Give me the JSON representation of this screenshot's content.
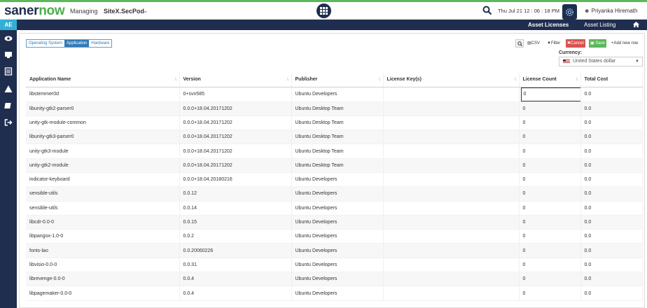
{
  "header": {
    "logo_part1": "saner",
    "logo_part2": "now",
    "managing_label": "Managing",
    "site_name": "SiteX.SecPod",
    "datetime": "Thu Jul 21  12 : 06 : 18 PM",
    "user_name": "Priyanka Hiremath"
  },
  "subnav": {
    "badge": "AE",
    "links": [
      "Asset Licenses",
      "Asset Listing"
    ]
  },
  "tabs": [
    {
      "label": "Operating System",
      "active": false
    },
    {
      "label": "Application",
      "active": true
    },
    {
      "label": "Hardware",
      "active": false
    }
  ],
  "toolbar": {
    "csv_label": "CSV",
    "filter_label": "Filter",
    "cancel_label": "Cancel",
    "save_label": "Save",
    "add_label": "Add new row"
  },
  "currency": {
    "label": "Currency:",
    "selected": "United States dollar"
  },
  "table": {
    "columns": [
      "Application Name",
      "Version",
      "Publisher",
      "License Key(s)",
      "License Count",
      "Total Cost"
    ],
    "rows": [
      [
        "libstemmer0d",
        "0+svn585",
        "Ubuntu Developers",
        "",
        "0",
        "0.0"
      ],
      [
        "libunity-gtk2-parser0",
        "0.0.0+18.04.20171202",
        "Ubuntu Desktop Team",
        "",
        "0",
        "0.0"
      ],
      [
        "unity-gtk-module-common",
        "0.0.0+18.04.20171202",
        "Ubuntu Desktop Team",
        "",
        "0",
        "0.0"
      ],
      [
        "libunity-gtk3-parser0",
        "0.0.0+18.04.20171202",
        "Ubuntu Desktop Team",
        "",
        "0",
        "0.0"
      ],
      [
        "unity-gtk3-module",
        "0.0.0+18.04.20171202",
        "Ubuntu Desktop Team",
        "",
        "0",
        "0.0"
      ],
      [
        "unity-gtk2-module",
        "0.0.0+18.04.20171202",
        "Ubuntu Desktop Team",
        "",
        "0",
        "0.0"
      ],
      [
        "indicator-keyboard",
        "0.0.0+18.04.20180216",
        "Ubuntu Developers",
        "",
        "0",
        "0.0"
      ],
      [
        "sensible-utils",
        "0.0.12",
        "Ubuntu Developers",
        "",
        "0",
        "0.0"
      ],
      [
        "sensible-utils",
        "0.0.14",
        "Ubuntu Developers",
        "",
        "0",
        "0.0"
      ],
      [
        "libcdr-0.0-0",
        "0.0.15",
        "Ubuntu Developers",
        "",
        "0",
        "0.0"
      ],
      [
        "libpangox-1.0-0",
        "0.0.2",
        "Ubuntu Developers",
        "",
        "0",
        "0.0"
      ],
      [
        "fonts-lao",
        "0.0.20060226",
        "Ubuntu Developers",
        "",
        "0",
        "0.0"
      ],
      [
        "libvisio-0.0-0",
        "0.0.31",
        "Ubuntu Developers",
        "",
        "0",
        "0.0"
      ],
      [
        "librevenge-0.0-0",
        "0.0.4",
        "Ubuntu Developers",
        "",
        "0",
        "0.0"
      ],
      [
        "libpagemaker-0.0-0",
        "0.0.4",
        "Ubuntu Developers",
        "",
        "0",
        "0.0"
      ]
    ]
  }
}
